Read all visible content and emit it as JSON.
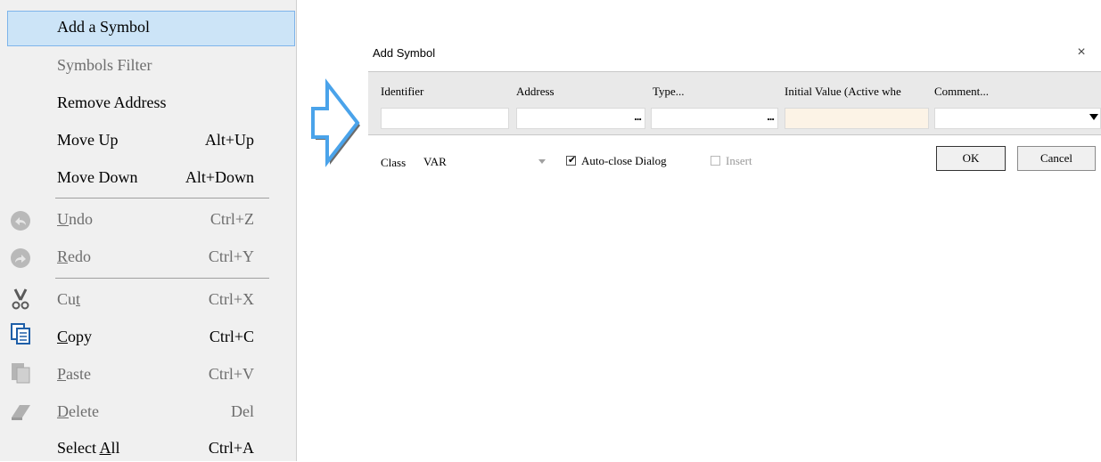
{
  "menu": {
    "items": [
      {
        "label": "Add a Symbol",
        "shortcut": ""
      },
      {
        "label": "Symbols Filter",
        "shortcut": ""
      },
      {
        "label": "Remove Address",
        "shortcut": ""
      },
      {
        "label": "Move Up",
        "shortcut": "Alt+Up"
      },
      {
        "label": "Move Down",
        "shortcut": "Alt+Down"
      },
      {
        "pre": "",
        "acc": "U",
        "post": "ndo",
        "shortcut": "Ctrl+Z",
        "icon": "undo-icon"
      },
      {
        "pre": "",
        "acc": "R",
        "post": "edo",
        "shortcut": "Ctrl+Y",
        "icon": "redo-icon"
      },
      {
        "pre": "Cu",
        "acc": "t",
        "post": "",
        "shortcut": "Ctrl+X",
        "icon": "cut-icon"
      },
      {
        "pre": "",
        "acc": "C",
        "post": "opy",
        "shortcut": "Ctrl+C",
        "icon": "copy-icon"
      },
      {
        "pre": "",
        "acc": "P",
        "post": "aste",
        "shortcut": "Ctrl+V",
        "icon": "paste-icon"
      },
      {
        "pre": "",
        "acc": "D",
        "post": "elete",
        "shortcut": "Del",
        "icon": "eraser-icon"
      },
      {
        "pre": "Select ",
        "acc": "A",
        "post": "ll",
        "shortcut": "Ctrl+A"
      }
    ]
  },
  "dialog": {
    "title": "Add Symbol",
    "close": "×",
    "columns": [
      "Identifier",
      "Address",
      "Type...",
      "Initial Value (Active whe",
      "Comment..."
    ],
    "ellipsis": "...",
    "class_label": "Class",
    "class_value": "VAR",
    "auto_close_label": "Auto-close Dialog",
    "insert_label": "Insert",
    "ok_label": "OK",
    "cancel_label": "Cancel",
    "check_mark": "✔"
  },
  "colors": {
    "highlight": "#cce4f7",
    "arrow": "#5aa9e6",
    "warm_cell": "#fcf3e6"
  }
}
